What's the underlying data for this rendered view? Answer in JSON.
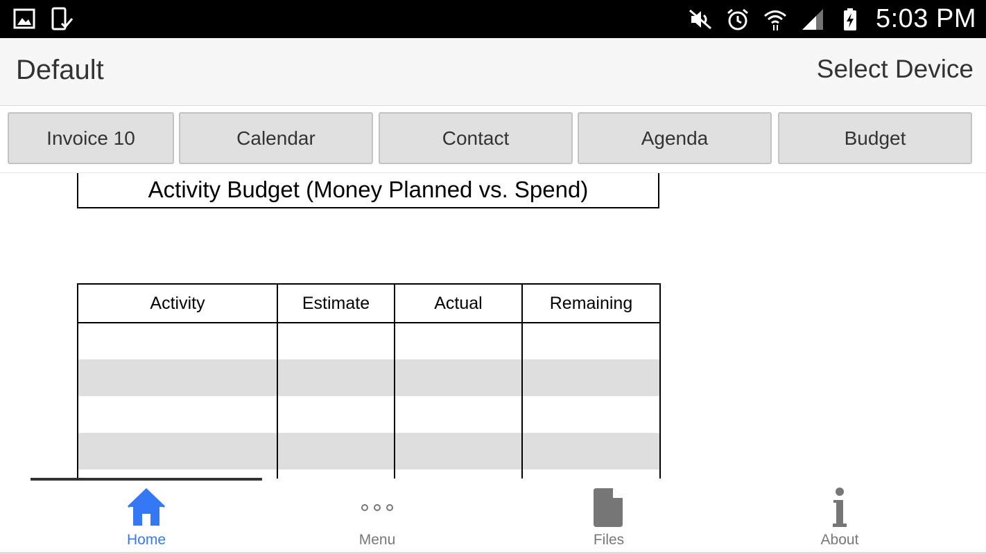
{
  "status_bar": {
    "time": "5:03 PM",
    "left_icons": [
      "gallery-icon",
      "device-check-icon"
    ],
    "right_icons": [
      "mute-icon",
      "alarm-icon",
      "wifi-icon",
      "signal-icon",
      "battery-charging-icon"
    ]
  },
  "app_bar": {
    "title": "Default",
    "action": "Select Device"
  },
  "tabs": [
    {
      "label": "Invoice 10"
    },
    {
      "label": "Calendar"
    },
    {
      "label": "Contact"
    },
    {
      "label": "Agenda"
    },
    {
      "label": "Budget"
    }
  ],
  "budget": {
    "title": "Activity Budget (Money Planned vs. Spend)",
    "columns": [
      "Activity",
      "Estimate",
      "Actual",
      "Remaining"
    ]
  },
  "bottom_nav": {
    "items": [
      {
        "label": "Home",
        "icon": "home-icon",
        "active": true
      },
      {
        "label": "Menu",
        "icon": "more-dots-icon",
        "active": false
      },
      {
        "label": "Files",
        "icon": "file-icon",
        "active": false
      },
      {
        "label": "About",
        "icon": "info-icon",
        "active": false
      }
    ]
  },
  "colors": {
    "accent": "#3478f6",
    "status_bar_bg": "#000000",
    "app_bar_bg": "#f7f7f7",
    "tab_bg": "#e0e0e0",
    "row_shade": "#dedede"
  }
}
